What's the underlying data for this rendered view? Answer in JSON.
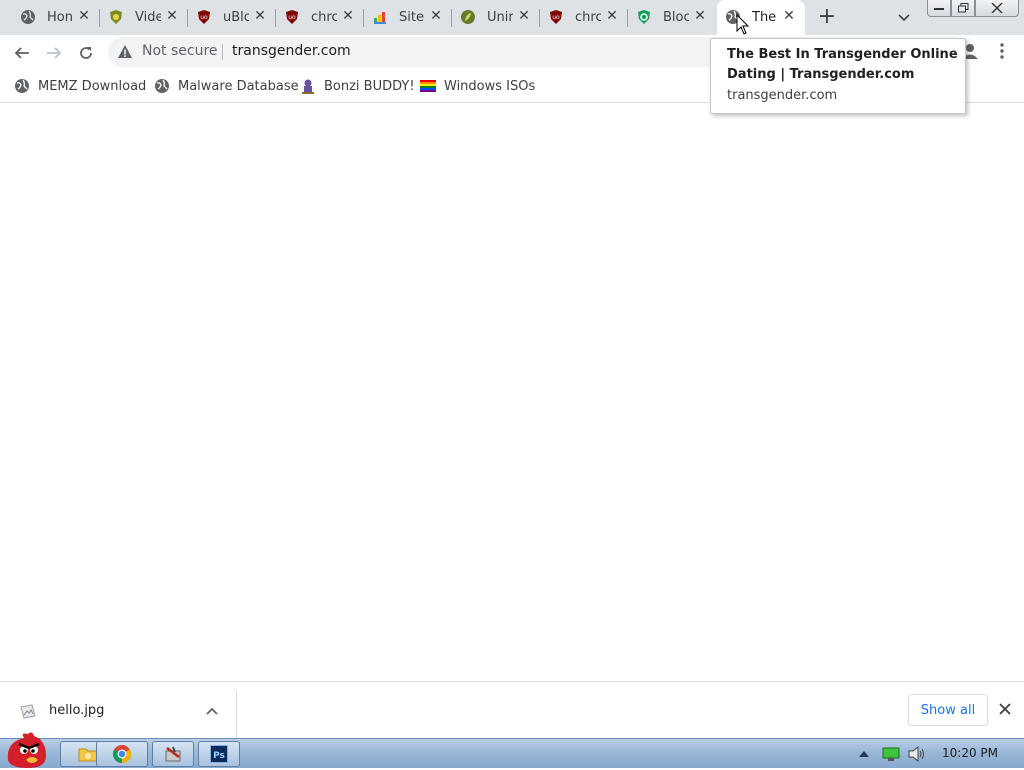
{
  "tabs": [
    {
      "title": "Hon",
      "favicon": "globe-icon"
    },
    {
      "title": "Vide",
      "favicon": "video-shield-icon"
    },
    {
      "title": "uBlc",
      "favicon": "ublock-icon"
    },
    {
      "title": "chrc",
      "favicon": "ublock-icon"
    },
    {
      "title": "Site",
      "favicon": "colorful-site-icon"
    },
    {
      "title": "Unir",
      "favicon": "leaf-icon"
    },
    {
      "title": "chrc",
      "favicon": "ublock-icon"
    },
    {
      "title": "Bloc",
      "favicon": "green-shield-icon"
    },
    {
      "title": "The",
      "favicon": "globe-icon",
      "active": true
    }
  ],
  "toolbar": {
    "security_label": "Not secure",
    "url": "transgender.com"
  },
  "bookmarks": [
    {
      "label": "MEMZ Download",
      "icon": "globe-icon"
    },
    {
      "label": "Malware Database",
      "icon": "globe-icon"
    },
    {
      "label": "Bonzi BUDDY!",
      "icon": "bonzi-icon"
    },
    {
      "label": "Windows ISOs",
      "icon": "rainbow-flag-icon"
    }
  ],
  "tooltip": {
    "title": "The Best In Transgender Online Dating | Transgender.com",
    "url": "transgender.com"
  },
  "downloads": {
    "file_name": "hello.jpg",
    "show_all_label": "Show all"
  },
  "taskbar": {
    "clock": "10:20 PM"
  },
  "colors": {
    "tabstrip": "#dee1e6",
    "accent_blue": "#1a73e8",
    "taskbar": "#9ab8d8"
  }
}
